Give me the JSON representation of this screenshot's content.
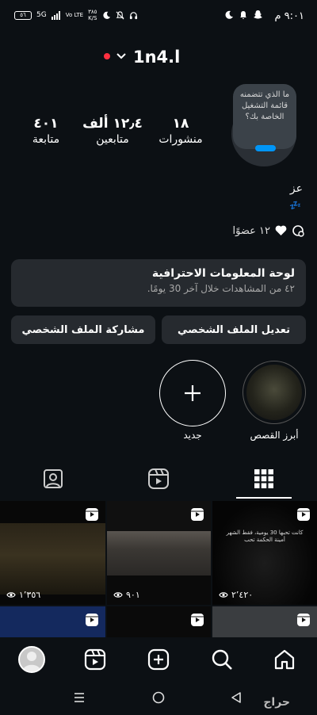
{
  "status_bar": {
    "time": "٩:٠١ م",
    "battery": "٥٦",
    "network": "5G",
    "volte": "Vo LTE",
    "speed_value": "٣٨٥",
    "speed_unit": "K/S"
  },
  "header": {
    "username": "1n4.l"
  },
  "profile": {
    "note_text": "ما الذي تتضمنه قائمة التشغيل الخاصة بك؟",
    "stats": [
      {
        "value": "١٨",
        "label": "منشورات"
      },
      {
        "value": "١٢٫٤ ألف",
        "label": "متابعين"
      },
      {
        "value": "٤٠١",
        "label": "متابعة"
      }
    ],
    "bio_name": "عز",
    "bio_emoji": "💤",
    "members_text": "١٢ عضوًا"
  },
  "dashboard": {
    "title": "لوحة المعلومات الاحترافية",
    "subtitle": "٤٢ من المشاهدات خلال آخر 30 يومًا."
  },
  "buttons": {
    "edit_profile": "تعديل الملف الشخصي",
    "share_profile": "مشاركة الملف الشخصي"
  },
  "highlights": [
    {
      "label": "أبرز القصص"
    },
    {
      "label": "جديد"
    }
  ],
  "grid": [
    {
      "views": "١٬٣٥٦",
      "type": "reel"
    },
    {
      "views": "٩٠١",
      "type": "reel"
    },
    {
      "views": "٢٬٤٢٠",
      "type": "reel",
      "overlay_text": "كانت تحبها 30 يومية، فقط الشهر أمينة الحكمة تحب"
    }
  ],
  "watermark": "حراج",
  "colors": {
    "background": "#0c1014",
    "card": "#262a2f",
    "accent": "#0095f6",
    "live_dot": "#ff3040"
  }
}
